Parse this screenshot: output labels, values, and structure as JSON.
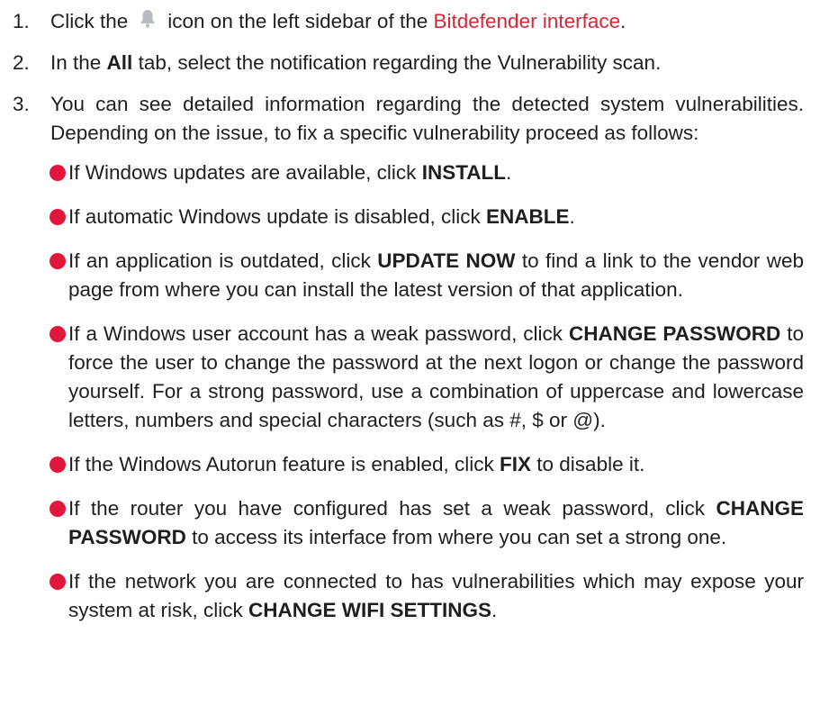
{
  "steps": [
    {
      "num": "1.",
      "before": "Click the",
      "icon": "bell-icon",
      "middle": "icon on the left sidebar of the",
      "link": "Bitdefender interface",
      "after": "."
    },
    {
      "num": "2.",
      "before": "In the ",
      "bold": "All",
      "after": " tab, select the notification regarding the Vulnerability scan."
    },
    {
      "num": "3.",
      "text": "You can see detailed information regarding the detected system vulnerabilities. Depending on the issue, to fix a specific vulnerability proceed as follows:"
    }
  ],
  "bullets": [
    {
      "before": "If Windows updates are available, click ",
      "bold": "INSTALL",
      "after": "."
    },
    {
      "before": "If automatic Windows update is disabled, click ",
      "bold": "ENABLE",
      "after": "."
    },
    {
      "before": "If an application is outdated, click ",
      "bold": "UPDATE NOW",
      "after": " to find a link to the vendor web page from where you can install the latest version of that application."
    },
    {
      "before": "If a Windows user account has a weak password, click ",
      "bold": "CHANGE PASSWORD",
      "after": " to force the user to change the password at the next logon or change the password yourself. For a strong password, use a combination of uppercase and lowercase letters, numbers and special characters (such as #, $ or @)."
    },
    {
      "before": "If the Windows Autorun feature is enabled, click ",
      "bold": "FIX",
      "after": " to disable it."
    },
    {
      "before": "If the router you have configured has set a weak password, click ",
      "bold": "CHANGE PASSWORD",
      "after": " to access its interface from where you can set a strong one."
    },
    {
      "before": "If the network you are connected to has vulnerabilities which may expose your system at risk, click ",
      "bold": "CHANGE WIFI SETTINGS",
      "after": "."
    }
  ],
  "colors": {
    "link": "#d4283a",
    "bullet": "#e0173a",
    "icon": "#b8bcc0"
  }
}
